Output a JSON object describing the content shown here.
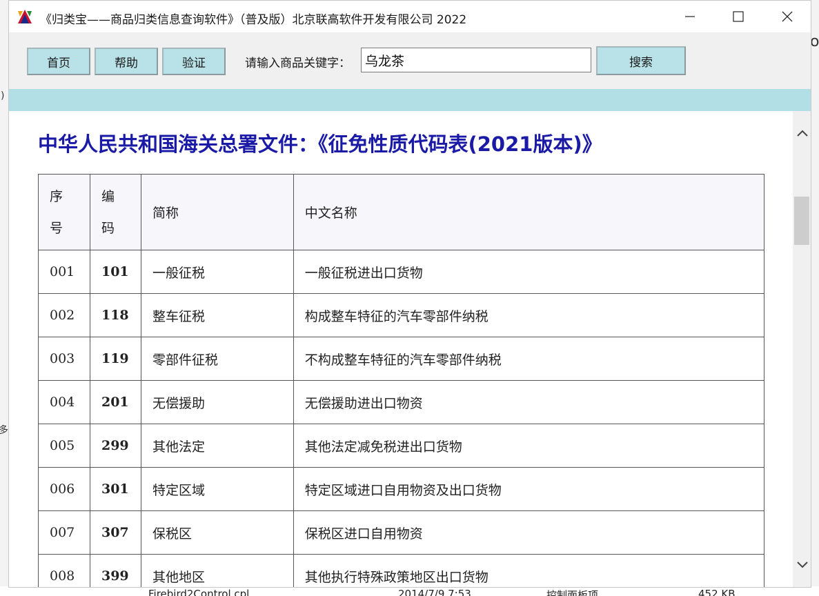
{
  "window": {
    "title": "《归类宝——商品归类信息查询软件》（普及版）北京联高软件开发有限公司 2022"
  },
  "toolbar": {
    "home_label": "首页",
    "help_label": "帮助",
    "verify_label": "验证",
    "search_label": "请输入商品关键字：",
    "search_value": "乌龙茶",
    "search_button_label": "搜索"
  },
  "document": {
    "title": "中华人民共和国海关总署文件：《征免性质代码表(2021版本)》",
    "table": {
      "headers": {
        "seq_top": "序",
        "seq_bottom": "号",
        "code_top": "编",
        "code_bottom": "码",
        "short_name": "简称",
        "full_name": "中文名称"
      },
      "rows": [
        {
          "seq": "001",
          "code": "101",
          "short": "一般征税",
          "name": "一般征税进出口货物"
        },
        {
          "seq": "002",
          "code": "118",
          "short": "整车征税",
          "name": "构成整车特征的汽车零部件纳税"
        },
        {
          "seq": "003",
          "code": "119",
          "short": "零部件征税",
          "name": "不构成整车特征的汽车零部件纳税"
        },
        {
          "seq": "004",
          "code": "201",
          "short": "无偿援助",
          "name": "无偿援助进出口物资"
        },
        {
          "seq": "005",
          "code": "299",
          "short": "其他法定",
          "name": "其他法定减免税进出口货物"
        },
        {
          "seq": "006",
          "code": "301",
          "short": "特定区域",
          "name": "特定区域进口自用物资及出口货物"
        },
        {
          "seq": "007",
          "code": "307",
          "short": "保税区",
          "name": "保税区进口自用物资"
        },
        {
          "seq": "008",
          "code": "399",
          "short": "其他地区",
          "name": "其他执行特殊政策地区出口货物"
        }
      ]
    }
  },
  "background": {
    "left_glyph_1": ")",
    "left_glyph_2": "多",
    "right_glyph": "o",
    "bottom_file": "Firebird2Control.cpl",
    "bottom_date": "2014/7/9 7:53",
    "bottom_type": "控制面板项",
    "bottom_size": "452 KB"
  },
  "colors": {
    "toolbar_button": "#b8e1e8",
    "band": "#b2dfe5",
    "title_blue": "#1a1aa6"
  },
  "icons": {
    "app": "app-logo-icon",
    "minimize": "minimize-icon",
    "maximize": "maximize-icon",
    "close": "close-icon",
    "scroll_up": "chevron-up-icon",
    "scroll_down": "chevron-down-icon"
  }
}
